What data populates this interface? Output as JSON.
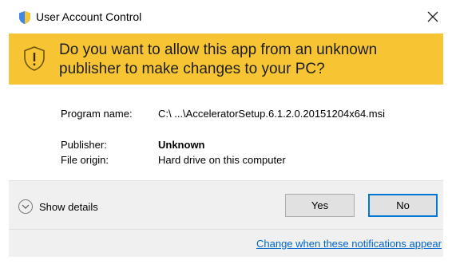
{
  "window": {
    "title": "User Account Control",
    "close_icon": "close-icon"
  },
  "banner": {
    "question": "Do you want to allow this app from an unknown publisher to make changes to your PC?",
    "icon": "warning-shield-icon",
    "color": "#f7c434"
  },
  "info": {
    "program_label": "Program name:",
    "program_value": "C:\\ ...\\AcceleratorSetup.6.1.2.0.20151204x64.msi",
    "publisher_label": "Publisher:",
    "publisher_value": "Unknown",
    "origin_label": "File origin:",
    "origin_value": "Hard drive on this computer"
  },
  "footer": {
    "details_label": "Show details",
    "yes_label": "Yes",
    "no_label": "No",
    "change_link": "Change when these notifications appear",
    "accent": "#0078d7"
  }
}
